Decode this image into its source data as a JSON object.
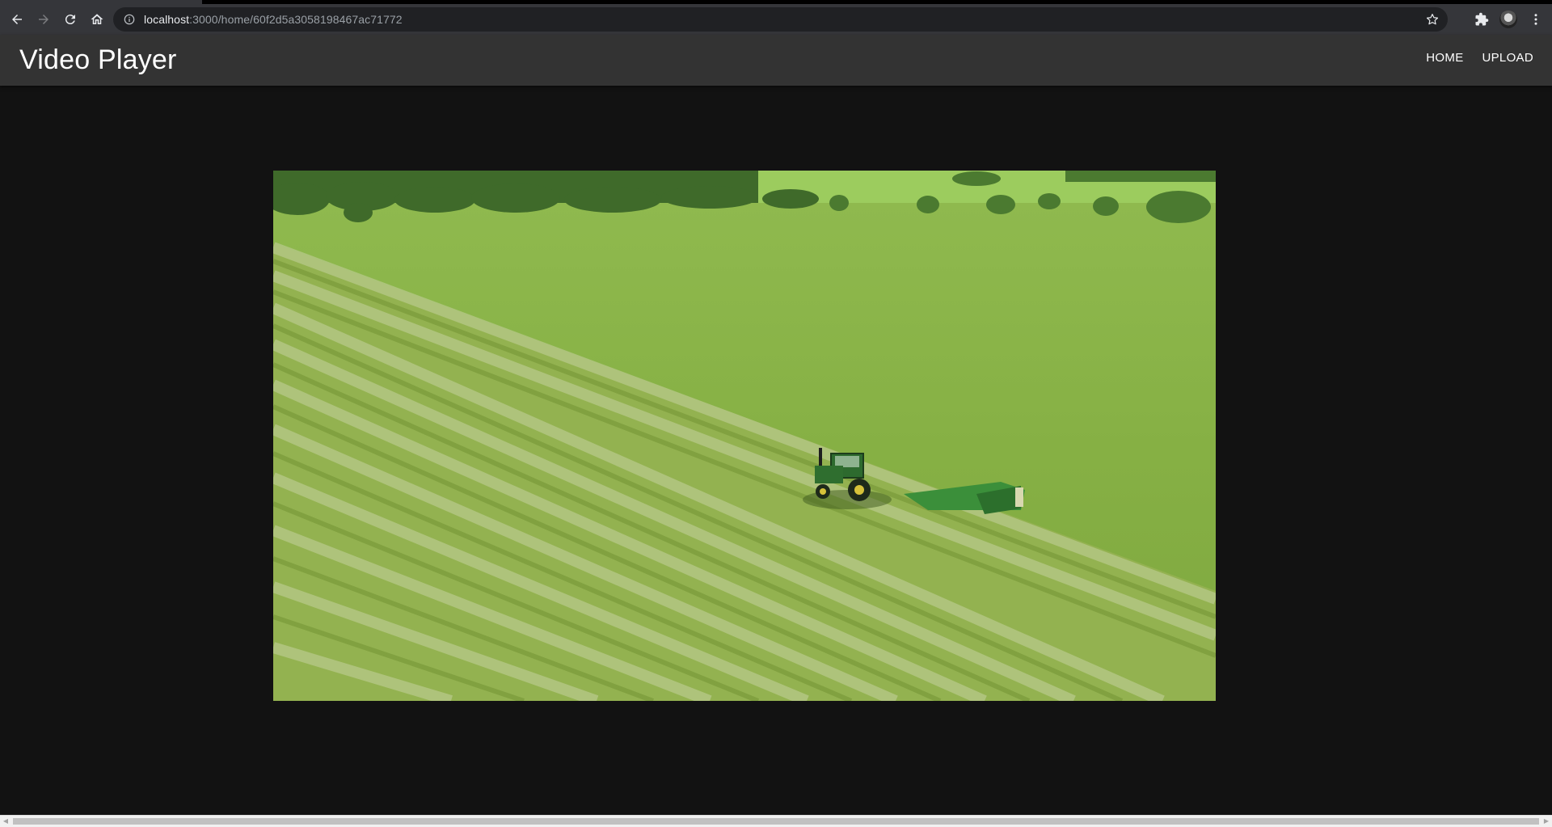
{
  "browser": {
    "url_host": "localhost",
    "url_rest": ":3000/home/60f2d5a3058198467ac71772",
    "icons": [
      "back-icon",
      "forward-icon",
      "reload-icon",
      "home-icon",
      "info-icon",
      "star-icon",
      "extensions-icon",
      "profile-avatar",
      "menu-icon"
    ]
  },
  "app": {
    "title": "Video Player",
    "nav": {
      "home": "HOME",
      "upload": "UPLOAD"
    }
  },
  "video": {
    "content": "aerial-tractor-mowing-field"
  },
  "colors": {
    "page_bg": "#121212",
    "appbar_bg": "#333333",
    "text": "#ffffff"
  }
}
